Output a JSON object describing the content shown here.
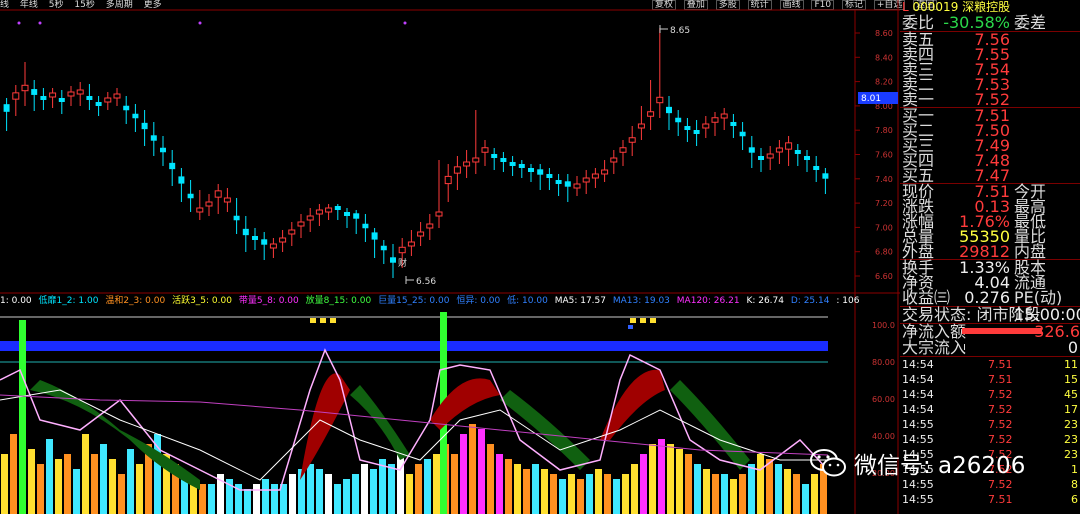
{
  "top_bar": {
    "periods": [
      "线",
      "年线",
      "5秒",
      "15秒",
      "多周期",
      "更多"
    ]
  },
  "toolbar": [
    "复权",
    "叠加",
    "多股",
    "统计",
    "画线",
    "F10",
    "标记",
    "+自选",
    "返回"
  ],
  "chart": {
    "high_label": "8.65",
    "low_label": "6.56",
    "marker_label": "财",
    "price_ticks": [
      "8.60",
      "8.40",
      "8.20",
      "8.00",
      "7.80",
      "7.60",
      "7.40",
      "7.20",
      "7.00",
      "6.80",
      "6.60"
    ],
    "current_price_tag": "8.01",
    "indicator_ticks": [
      "100.0",
      "80.00",
      "60.00",
      "40.00",
      "20.00"
    ]
  },
  "indicator_legend": [
    {
      "text": "1: 0.00",
      "color": "#ffffff"
    },
    {
      "text": "低靡1_2: 1.00",
      "color": "#00e5ff"
    },
    {
      "text": "温和2_3: 0.00",
      "color": "#ff9020"
    },
    {
      "text": "活跃3_5: 0.00",
      "color": "#ffff30"
    },
    {
      "text": "带量5_8: 0.00",
      "color": "#ff30ff"
    },
    {
      "text": "放量8_15: 0.00",
      "color": "#40ff40"
    },
    {
      "text": "巨量15_25: 0.00",
      "color": "#3080ff"
    },
    {
      "text": "恒异: 0.00",
      "color": "#3080ff"
    },
    {
      "text": "低: 10.00",
      "color": "#3080ff"
    },
    {
      "text": "MA5: 17.57",
      "color": "#ffffff"
    },
    {
      "text": "MA13: 19.03",
      "color": "#3080ff"
    },
    {
      "text": "MA120: 26.21",
      "color": "#ff30ff"
    },
    {
      "text": "K: 26.74",
      "color": "#ffffff"
    },
    {
      "text": "D: 25.14",
      "color": "#3080ff"
    },
    {
      "text": ": 106.00 TJJR",
      "color": "#ffffff"
    }
  ],
  "quote": {
    "code_prefix": "L",
    "code": "000019",
    "name": "深粮控股",
    "weibi_label": "委比",
    "weibi_value": "-30.58%",
    "weicha_label": "委差",
    "asks": [
      {
        "label": "卖五",
        "price": "7.56"
      },
      {
        "label": "卖四",
        "price": "7.55"
      },
      {
        "label": "卖三",
        "price": "7.54"
      },
      {
        "label": "卖二",
        "price": "7.53"
      },
      {
        "label": "卖一",
        "price": "7.52"
      }
    ],
    "bids": [
      {
        "label": "买一",
        "price": "7.51"
      },
      {
        "label": "买二",
        "price": "7.50"
      },
      {
        "label": "买三",
        "price": "7.49"
      },
      {
        "label": "买四",
        "price": "7.48"
      },
      {
        "label": "买五",
        "price": "7.47"
      }
    ],
    "stats": [
      {
        "label": "现价",
        "value": "7.51",
        "label2": "今开",
        "color": "red"
      },
      {
        "label": "涨跌",
        "value": "0.13",
        "label2": "最高",
        "color": "red"
      },
      {
        "label": "涨幅",
        "value": "1.76%",
        "label2": "最低",
        "color": "red"
      },
      {
        "label": "总量",
        "value": "55350",
        "label2": "量比",
        "color": "yellow"
      },
      {
        "label": "外盘",
        "value": "29812",
        "label2": "内盘",
        "color": "red"
      }
    ],
    "stats2": [
      {
        "label": "换手",
        "value": "1.33%",
        "label2": "股本"
      },
      {
        "label": "净资",
        "value": "4.04",
        "label2": "流通"
      },
      {
        "label": "收益㈢",
        "value": "0.276",
        "label2": "PE(动)"
      }
    ],
    "net_inflow_label": "净流入额",
    "net_inflow_value": "326.6",
    "block_inflow_label": "大宗流入",
    "block_inflow_value": "0",
    "trades": [
      {
        "time": "14:54",
        "price": "7.51",
        "vol": "11"
      },
      {
        "time": "14:54",
        "price": "7.51",
        "vol": "15"
      },
      {
        "time": "14:54",
        "price": "7.52",
        "vol": "45"
      },
      {
        "time": "14:54",
        "price": "7.52",
        "vol": "17"
      },
      {
        "time": "14:55",
        "price": "7.52",
        "vol": "23"
      },
      {
        "time": "14:55",
        "price": "7.52",
        "vol": "23"
      },
      {
        "time": "14:55",
        "price": "7.52",
        "vol": "23"
      },
      {
        "time": "14:55",
        "price": "7.52",
        "vol": "1"
      },
      {
        "time": "14:55",
        "price": "7.52",
        "vol": "8"
      },
      {
        "time": "14:55",
        "price": "7.51",
        "vol": "6"
      }
    ],
    "trade_status_label": "交易状态: 闭市阶段",
    "trade_status_time": "15:00:00"
  },
  "watermark": {
    "text": "微信号: a26206"
  }
}
